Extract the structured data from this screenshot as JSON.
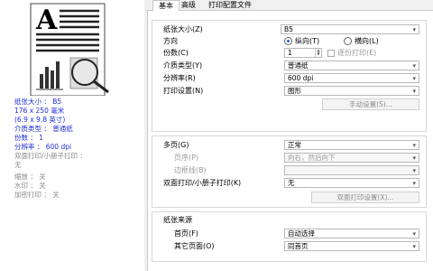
{
  "summary": {
    "paper_size": "纸张大小 ： B5",
    "paper_dims_mm": "176 x 250 毫米",
    "paper_dims_in": "(6.9 x 9.8 英寸)",
    "media_type": "介质类型 ： 普通纸",
    "copies": "份数 ： 1",
    "resolution": "分辨率 ： 600 dpi",
    "duplex": "双面打印/小册子打印 ：",
    "duplex_value": "无",
    "scaling": "缩放 ： 关",
    "watermark": "水印 ： 关",
    "header_footer": "加密打印 ： 关"
  },
  "tabs": [
    "基本",
    "高级",
    "打印配置文件"
  ],
  "basic": {
    "paper_size_label": "纸张大小(Z)",
    "paper_size_value": "B5",
    "orientation_label": "方向",
    "portrait_label": "纵向(T)",
    "landscape_label": "横向(L)",
    "copies_label": "份数(C)",
    "copies_value": "1",
    "collate_label": "逐份打印(E)",
    "media_label": "介质类型(Y)",
    "media_value": "普通纸",
    "resolution_label": "分辨率(R)",
    "resolution_value": "600 dpi",
    "print_settings_label": "打印设置(N)",
    "print_settings_value": "图形",
    "manual_settings_button": "手动设置(S)..."
  },
  "layout": {
    "multipage_label": "多页(G)",
    "multipage_value": "正常",
    "page_order_label": "页序(P)",
    "page_order_value": "向右，然后向下",
    "border_label": "边框线(B)",
    "border_value": "",
    "duplex_label": "双面打印/小册子打印(K)",
    "duplex_value": "无",
    "duplex_settings_button": "双面打印设置(X)..."
  },
  "source": {
    "title": "纸张来源",
    "first_page_label": "首页(F)",
    "first_page_value": "自动选择",
    "other_pages_label": "其它页面(O)",
    "other_pages_value": "同首页"
  },
  "colors": {
    "summary_blue": "#1e2fd6",
    "disabled_gray": "#9a9a9a",
    "radio_blue": "#1e5fd6"
  }
}
